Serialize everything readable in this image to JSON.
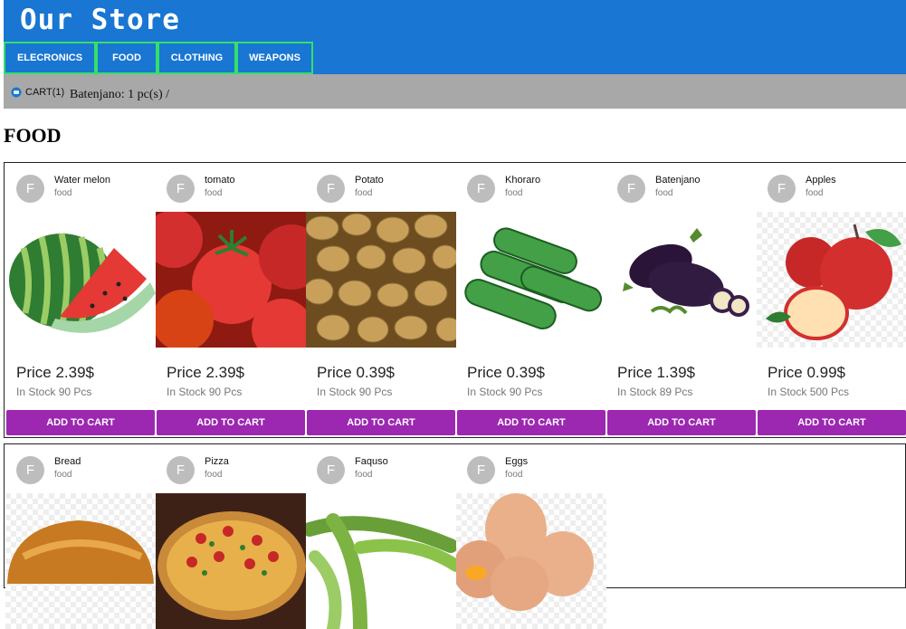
{
  "store": {
    "title": "Our Store"
  },
  "nav": {
    "items": [
      {
        "label": "ELECRONICS"
      },
      {
        "label": "FOOD"
      },
      {
        "label": "CLOTHING"
      },
      {
        "label": "WEAPONS"
      }
    ]
  },
  "cart": {
    "label": "CART(1)",
    "contents": "Batenjano: 1 pc(s) /"
  },
  "section": {
    "title": "FOOD"
  },
  "products": [
    {
      "avatar": "F",
      "name": "Water melon",
      "category": "food",
      "price": "Price 2.39$",
      "stock": "In Stock 90 Pcs",
      "button": "ADD TO CART"
    },
    {
      "avatar": "F",
      "name": "tomato",
      "category": "food",
      "price": "Price 2.39$",
      "stock": "In Stock 90 Pcs",
      "button": "ADD TO CART"
    },
    {
      "avatar": "F",
      "name": "Potato",
      "category": "food",
      "price": "Price 0.39$",
      "stock": "In Stock 90 Pcs",
      "button": "ADD TO CART"
    },
    {
      "avatar": "F",
      "name": "Khoraro",
      "category": "food",
      "price": "Price 0.39$",
      "stock": "In Stock 90 Pcs",
      "button": "ADD TO CART"
    },
    {
      "avatar": "F",
      "name": "Batenjano",
      "category": "food",
      "price": "Price 1.39$",
      "stock": "In Stock 89 Pcs",
      "button": "ADD TO CART"
    },
    {
      "avatar": "F",
      "name": "Apples",
      "category": "food",
      "price": "Price 0.99$",
      "stock": "In Stock 500 Pcs",
      "button": "ADD TO CART"
    },
    {
      "avatar": "F",
      "name": "Bread",
      "category": "food"
    },
    {
      "avatar": "F",
      "name": "Pizza",
      "category": "food"
    },
    {
      "avatar": "F",
      "name": "Faquso",
      "category": "food"
    },
    {
      "avatar": "F",
      "name": "Eggs",
      "category": "food"
    }
  ],
  "colors": {
    "header": "#1976d2",
    "nav_border": "#33e06a",
    "cartbar": "#a8a8a8",
    "button": "#9c27b0",
    "avatar": "#bdbdbd"
  },
  "icons": {
    "cart": "cart-icon"
  }
}
